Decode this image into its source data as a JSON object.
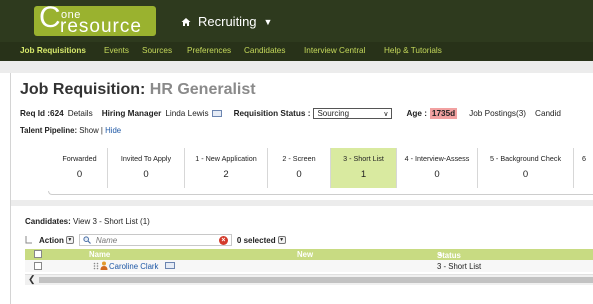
{
  "header": {
    "logo_one": "one",
    "logo_resource": "resource",
    "module_label": "Recruiting",
    "nav": [
      {
        "label": "Job Requisitions",
        "active": true
      },
      {
        "label": "Events"
      },
      {
        "label": "Sources"
      },
      {
        "label": "Preferences"
      },
      {
        "label": "Candidates"
      },
      {
        "label": "Interview Central"
      },
      {
        "label": "Help & Tutorials"
      }
    ]
  },
  "page": {
    "title_prefix": "Job Requisition:",
    "title_name": "HR Generalist",
    "req_id_label": "Req Id :624",
    "details_link": "Details",
    "hiring_manager_label": "Hiring Manager",
    "hiring_manager_value": "Linda Lewis",
    "req_status_label": "Requisition Status :",
    "req_status_value": "Sourcing",
    "age_label": "Age :",
    "age_value": "1735d",
    "job_postings": "Job Postings(3)",
    "candid_truncated": "Candid",
    "talent_pipeline_label": "Talent Pipeline:",
    "talent_show": "Show",
    "talent_sep": "|",
    "talent_hide": "Hide"
  },
  "pipeline": [
    {
      "label": "Forwarded",
      "count": "0"
    },
    {
      "label": "Invited To Apply",
      "count": "0"
    },
    {
      "label": "1 - New Application",
      "count": "2"
    },
    {
      "label": "2 - Screen",
      "count": "0"
    },
    {
      "label": "3 - Short List",
      "count": "1",
      "active": true
    },
    {
      "label": "4 - Interview-Assess",
      "count": "0"
    },
    {
      "label": "5 - Background Check",
      "count": "0"
    },
    {
      "label": "6",
      "count": ""
    }
  ],
  "candidates": {
    "title_label": "Candidates:",
    "title_value": "View 3 - Short List (1)",
    "action_label": "Action",
    "search_placeholder": "Name",
    "selected_label": "0 selected",
    "columns": {
      "name": "Name",
      "new": "New",
      "status": "Status"
    },
    "rows": [
      {
        "name": "Caroline Clark",
        "new": "",
        "status": "3 - Short List"
      }
    ]
  },
  "colors": {
    "header_bg": "#2e3a1e",
    "nav_text": "#c5d95b",
    "logo_green": "#9ab22f",
    "active_stage": "#d9eaa0",
    "table_header": "#c8db82",
    "age_badge": "#f2a1a1",
    "link": "#1d57a5"
  },
  "icons": [
    "home-icon",
    "chevron-down-icon",
    "card-icon",
    "search-icon",
    "clear-icon",
    "drag-handle-icon",
    "person-icon",
    "sort-asc-icon",
    "scroll-left-icon"
  ]
}
